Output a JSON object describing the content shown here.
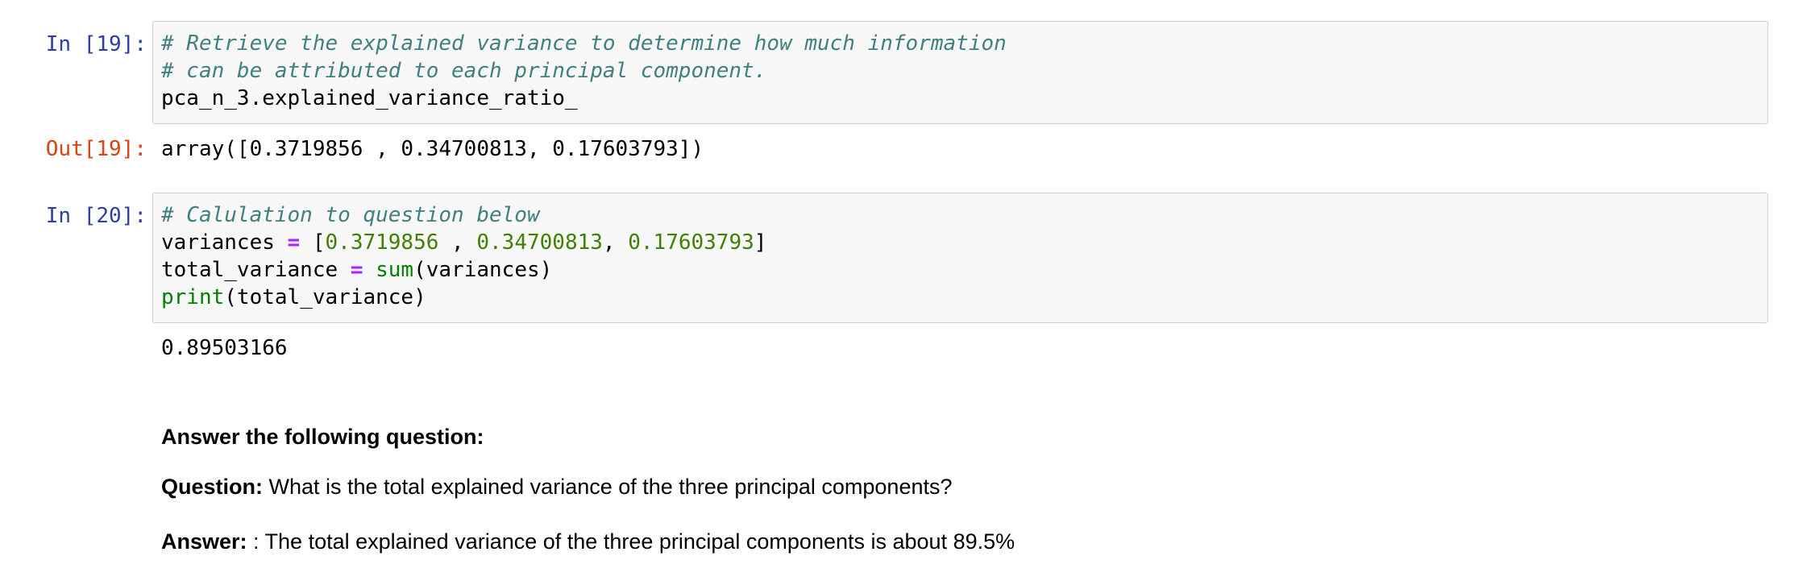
{
  "cells": {
    "in19": {
      "prompt": "In [19]:",
      "lines": {
        "l1": "# Retrieve the explained variance to determine how much information",
        "l2": "# can be attributed to each principal component.",
        "l3": "pca_n_3.explained_variance_ratio_"
      }
    },
    "out19": {
      "prompt": "Out[19]:",
      "text": "array([0.3719856 , 0.34700813, 0.17603793])"
    },
    "in20": {
      "prompt": "In [20]:",
      "lines": {
        "l1": "# Calulation to question below",
        "l2_var": "variances",
        "l2_eq": "=",
        "l2_open": "[",
        "l2_v1": "0.3719856",
        "l2_sep1": " , ",
        "l2_v2": "0.34700813",
        "l2_sep2": ", ",
        "l2_v3": "0.17603793",
        "l2_close": "]",
        "l3_var": "total_variance",
        "l3_eq": "=",
        "l3_fn": "sum",
        "l3_arg": "(variances)",
        "l4_fn": "print",
        "l4_arg": "(total_variance)"
      },
      "stdout": "0.89503166"
    },
    "markdown": {
      "heading": "Answer the following question:",
      "question_label": "Question:",
      "question_text": " What is the total explained variance of the three principal components?",
      "answer_label": "Answer:",
      "answer_text": " : The total explained variance of the three principal components is about 89.5%"
    }
  },
  "colors": {
    "prompt_in": "#303f9f",
    "prompt_out": "#d84315",
    "comment": "#408080",
    "number": "#408000",
    "operator": "#aa22ff",
    "builtin": "#008000",
    "code_bg": "#f7f7f7"
  }
}
